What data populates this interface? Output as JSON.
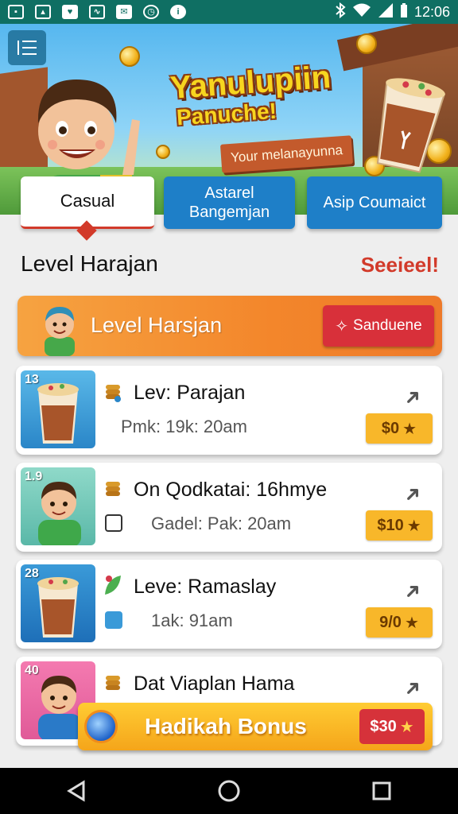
{
  "status_bar": {
    "time": "12:06",
    "notification_icons": [
      "image-icon",
      "gallery-icon",
      "heart-icon",
      "chart-icon",
      "app-icon",
      "alarm-icon",
      "info-icon"
    ],
    "right_icons": [
      "bluetooth-icon",
      "wifi-icon",
      "signal-icon",
      "battery-icon"
    ]
  },
  "hero": {
    "title": "Yanulupiin",
    "subtitle": "Panuche!",
    "ribbon": "Your melanayunna"
  },
  "tabs": [
    {
      "label": "Casual",
      "active": true
    },
    {
      "label": "Astarel Bangemjan",
      "active": false
    },
    {
      "label": "Asip Coumaict",
      "active": false
    }
  ],
  "section": {
    "title": "Level Harajan",
    "link": "Seeieel!"
  },
  "level_banner": {
    "text": "Level Harsjan",
    "button_label": "Sanduene"
  },
  "cards": [
    {
      "num": "13",
      "title": "Lev: Parajan",
      "sub": "Pmk: 19k: 20am",
      "price": "$0",
      "thumb": "drink"
    },
    {
      "num": "1.9",
      "title": "On Qodkatai: 16hmye",
      "sub": "Gadel: Pak: 20am",
      "price": "$10",
      "thumb": "boy-green"
    },
    {
      "num": "28",
      "title": "Leve: Ramaslay",
      "sub": "1ak: 91am",
      "price": "9/0",
      "thumb": "drink"
    },
    {
      "num": "40",
      "title": "Dat Viaplan Hama",
      "sub": "",
      "price": "",
      "thumb": "boy-blue"
    }
  ],
  "bonus": {
    "text": "Hadikah Bonus",
    "price": "$30"
  },
  "colors": {
    "status_bar": "#0f6f63",
    "accent_red": "#d23a2a",
    "tab_blue": "#1e7fc8",
    "banner_orange": "#f3862b",
    "price_yellow": "#f8b72a"
  }
}
